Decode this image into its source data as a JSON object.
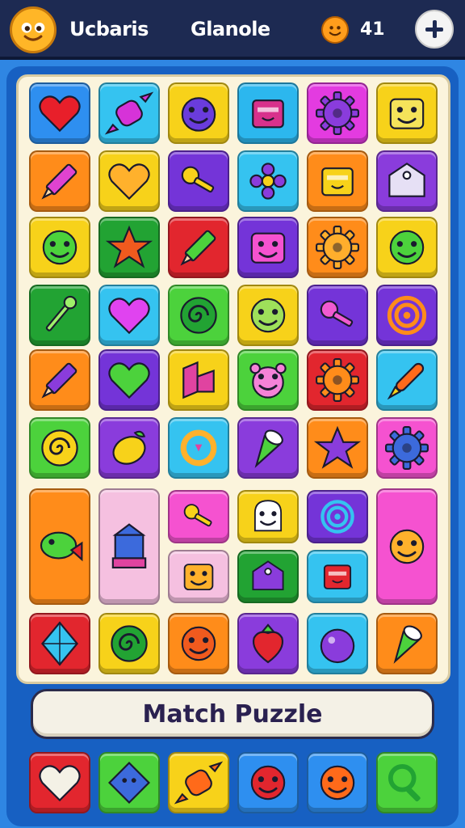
{
  "header": {
    "player_name": "Ucbaris",
    "game_title": "Glanole",
    "coin_count": "41"
  },
  "footer": {
    "title": "Match Puzzle"
  },
  "board": {
    "rows": [
      [
        {
          "bg": "#2e8ff0",
          "icon": "heart-icon",
          "color": "#e81f2a"
        },
        {
          "bg": "#35c3f0",
          "icon": "candy-icon",
          "color": "#d633d8"
        },
        {
          "bg": "#f7d21a",
          "icon": "ball-icon",
          "color": "#6a3cdc"
        },
        {
          "bg": "#2cb7ee",
          "icon": "box-icon",
          "color": "#d8318c"
        },
        {
          "bg": "#e33be0",
          "icon": "gear-icon",
          "color": "#8a3cdc"
        },
        {
          "bg": "#f7d21a",
          "icon": "block-face-icon",
          "color": "#f5e35a"
        }
      ],
      [
        {
          "bg": "#ff8c1a",
          "icon": "pencil-icon",
          "color": "#e043d0"
        },
        {
          "bg": "#f7d21a",
          "icon": "heart-icon",
          "color": "#ffb12c"
        },
        {
          "bg": "#7434d8",
          "icon": "key-icon",
          "color": "#f7d21a"
        },
        {
          "bg": "#35c3f0",
          "icon": "flower-icon",
          "color": "#8a3cdc"
        },
        {
          "bg": "#ff8c1a",
          "icon": "box-icon",
          "color": "#f7d21a"
        },
        {
          "bg": "#8a3cdc",
          "icon": "tag-icon",
          "color": "#e6e0f5"
        }
      ],
      [
        {
          "bg": "#f7d21a",
          "icon": "smiley-icon",
          "color": "#4cd23c"
        },
        {
          "bg": "#22a333",
          "icon": "star-icon",
          "color": "#f05a1e"
        },
        {
          "bg": "#e2262e",
          "icon": "pencil-icon",
          "color": "#4cd23c"
        },
        {
          "bg": "#7434d8",
          "icon": "block-face-icon",
          "color": "#f552d0"
        },
        {
          "bg": "#ff8c1a",
          "icon": "gear-icon",
          "color": "#ffae2c"
        },
        {
          "bg": "#f7d21a",
          "icon": "smiley-icon",
          "color": "#4cd23c"
        }
      ],
      [
        {
          "bg": "#22a333",
          "icon": "pin-icon",
          "color": "#9ef06a"
        },
        {
          "bg": "#35c3f0",
          "icon": "heart-icon",
          "color": "#e043f0"
        },
        {
          "bg": "#4cd23c",
          "icon": "swirl-icon",
          "color": "#22a333"
        },
        {
          "bg": "#f7d21a",
          "icon": "smiley-icon",
          "color": "#9ee05a"
        },
        {
          "bg": "#7434d8",
          "icon": "key-icon",
          "color": "#f05ad0"
        },
        {
          "bg": "#7434d8",
          "icon": "target-icon",
          "color": "#ff8c1a"
        }
      ],
      [
        {
          "bg": "#ff8c1a",
          "icon": "pencil-icon",
          "color": "#8a3cdc"
        },
        {
          "bg": "#7434d8",
          "icon": "heart-icon",
          "color": "#4cd23c"
        },
        {
          "bg": "#f7d21a",
          "icon": "block-icon",
          "color": "#e043a0"
        },
        {
          "bg": "#4cd23c",
          "icon": "monster-icon",
          "color": "#f582d8"
        },
        {
          "bg": "#e2262e",
          "icon": "gear-icon",
          "color": "#ff8c1a"
        },
        {
          "bg": "#35c3f0",
          "icon": "rocket-icon",
          "color": "#ff6a1a"
        }
      ],
      [
        {
          "bg": "#4cd23c",
          "icon": "swirl-icon",
          "color": "#f7d21a"
        },
        {
          "bg": "#8a3cdc",
          "icon": "lemon-icon",
          "color": "#f7d21a"
        },
        {
          "bg": "#35c3f0",
          "icon": "ring-icon",
          "color": "#ffb12c"
        },
        {
          "bg": "#8a3cdc",
          "icon": "cone-icon",
          "color": "#4cd23c"
        },
        {
          "bg": "#ff8c1a",
          "icon": "star-icon",
          "color": "#8a3cdc"
        },
        {
          "bg": "#f552d0",
          "icon": "gear-icon",
          "color": "#3c6adc"
        }
      ]
    ],
    "big_tiles": [
      {
        "bg": "#ff8c1a",
        "icon": "fish-icon",
        "color": "#4cd23c"
      },
      {
        "bg": "#f5c0e0",
        "icon": "tower-icon",
        "color": "#3c6adc"
      },
      {
        "bg": "#f552d0",
        "icon": "key-icon",
        "color": "#f7d21a"
      },
      {
        "bg": "#f7d21a",
        "icon": "ghost-icon",
        "color": "#ffffff"
      },
      {
        "bg": "#7434d8",
        "icon": "target-icon",
        "color": "#35c3f0"
      },
      {
        "bg": "#f552d0",
        "icon": "smiley-icon",
        "color": "#ffb12c"
      },
      {
        "bg": "#f5c0e0",
        "icon": "block-face-icon",
        "color": "#ffb12c"
      },
      {
        "bg": "#22a333",
        "icon": "tag-icon",
        "color": "#8a3cdc"
      },
      {
        "bg": "#35c3f0",
        "icon": "box-icon",
        "color": "#e2262e"
      }
    ],
    "last_row": [
      {
        "bg": "#e2262e",
        "icon": "kite-icon",
        "color": "#35c3f0"
      },
      {
        "bg": "#f7d21a",
        "icon": "swirl-icon",
        "color": "#22a333"
      },
      {
        "bg": "#ff8c1a",
        "icon": "smiley-icon",
        "color": "#f05a1e"
      },
      {
        "bg": "#8a3cdc",
        "icon": "strawberry-icon",
        "color": "#e2262e"
      },
      {
        "bg": "#35c3f0",
        "icon": "orb-icon",
        "color": "#8a3cdc"
      },
      {
        "bg": "#ff8c1a",
        "icon": "cone-icon",
        "color": "#4cd23c"
      }
    ]
  },
  "tray": [
    {
      "bg": "#e2262e",
      "icon": "heart-icon",
      "color": "#f4f1e6"
    },
    {
      "bg": "#4cd23c",
      "icon": "diamond-icon",
      "color": "#3c6adc"
    },
    {
      "bg": "#f7d21a",
      "icon": "candy-icon",
      "color": "#ff6a1a"
    },
    {
      "bg": "#2e8ff0",
      "icon": "smiley-icon",
      "color": "#e2262e"
    },
    {
      "bg": "#2e8ff0",
      "icon": "smiley-icon",
      "color": "#ff6a1a"
    },
    {
      "bg": "#4cd23c",
      "icon": "search-icon",
      "color": "#22a333"
    }
  ]
}
